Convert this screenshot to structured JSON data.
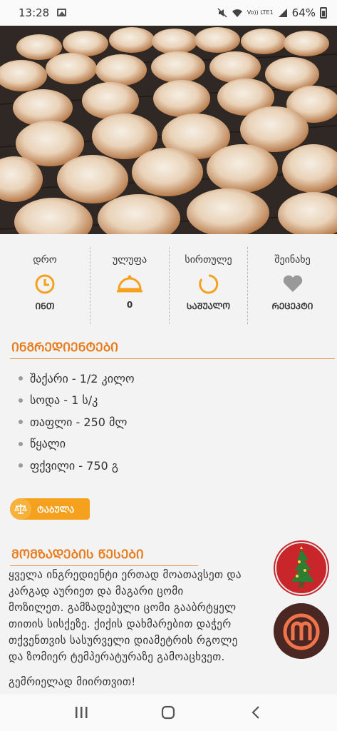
{
  "status": {
    "time": "13:28",
    "network": "Vo)) LTE1",
    "battery": "64%"
  },
  "info": [
    {
      "label": "დრო",
      "value": "ᲘᲜᲗ",
      "icon": "clock-icon"
    },
    {
      "label": "ულუფა",
      "value": "0",
      "icon": "serving-dish-icon"
    },
    {
      "label": "სირთულე",
      "value": "ᲡᲐᲨᲣᲐᲚᲝ",
      "icon": "difficulty-icon"
    },
    {
      "label": "შეინახე",
      "value": "ᲠᲔᲪᲔᲞᲢᲘ",
      "icon": "heart-icon"
    }
  ],
  "ingredients": {
    "title": "ᲘᲜᲒᲠᲔᲓᲘᲔᲜᲢᲔᲑᲘ",
    "items": [
      "შაქარი - 1/2 კილო",
      "სოდა - 1 ს/კ",
      "თაფლი - 250 მლ",
      "წყალი",
      "ფქვილი - 750 გ"
    ]
  },
  "scale_button": {
    "label": "ᲢᲐᲑᲣᲚᲐ"
  },
  "steps": {
    "title": "ᲛᲝᲛᲖᲐᲓᲔᲑᲘᲡ ᲬᲔᲡᲔᲑᲘ",
    "lines": [
      " ყველა ინგრედიენტი ერთად მოათავსეთ და",
      "კარგად აურიეთ და მაგარი ცომი",
      "მოზილეთ. გამზადებული ცომი გააბრტყელ",
      "თითის სისქეზე.  ქიქის დახმარებით დაჭერ",
      "თქვენთვის სასურველი დიამეტრის რგოლე",
      "და ზომიერ ტემპერატურაზე გამოაცხვეთ.",
      "",
      "გემრიელად მიირთვით!"
    ]
  },
  "colors": {
    "accent": "#e87b1c",
    "button": "#f5a11e"
  }
}
